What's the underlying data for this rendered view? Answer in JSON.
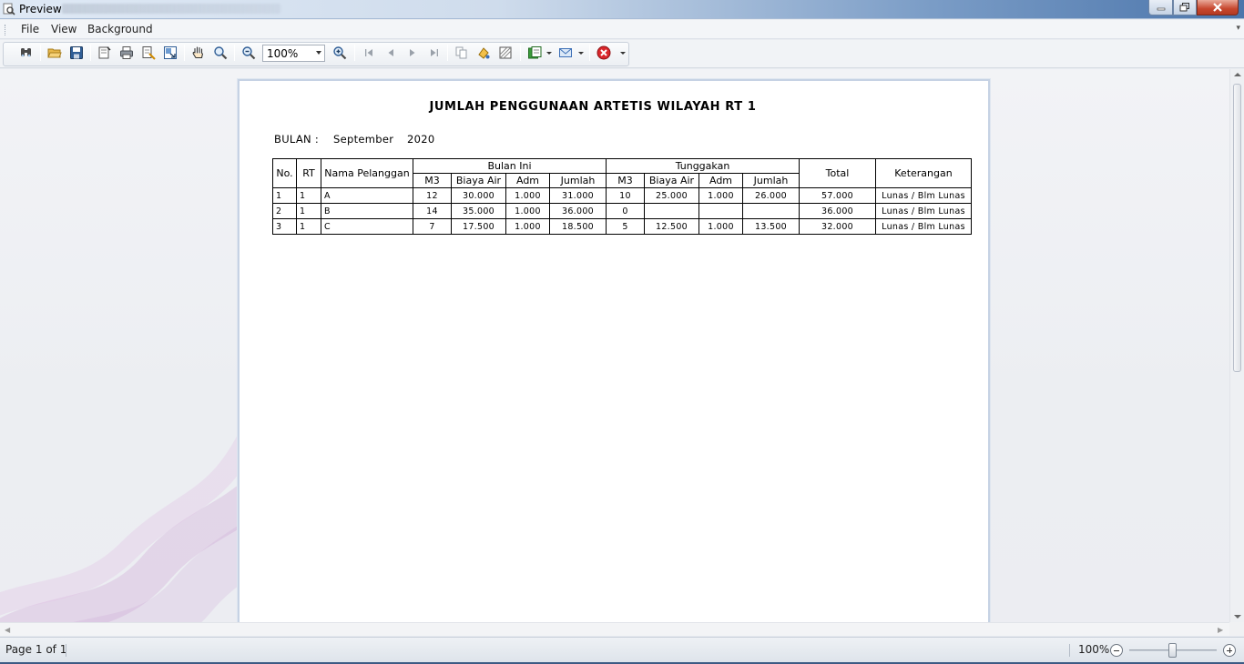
{
  "window": {
    "title": "Preview",
    "icon": "magnifier-document-icon"
  },
  "menu": {
    "items": [
      {
        "label": "File"
      },
      {
        "label": "View"
      },
      {
        "label": "Background"
      }
    ]
  },
  "toolbar": {
    "zoom_value": "100%",
    "buttons": [
      "search-icon",
      "open-icon",
      "save-icon",
      "page-setup-icon",
      "print-icon",
      "quick-print-icon",
      "export-icon",
      "hand-tool-icon",
      "magnifier-icon",
      "zoom-out-icon",
      "zoom-in-icon",
      "first-page-icon",
      "previous-page-icon",
      "next-page-icon",
      "last-page-icon",
      "multiple-pages-icon",
      "color-icon",
      "watermark-icon",
      "export-document-icon",
      "email-icon",
      "close-preview-icon"
    ]
  },
  "report": {
    "title": "JUMLAH PENGGUNAAN ARTETIS WILAYAH  RT  1",
    "month_label": "BULAN :",
    "month": "September",
    "year": "2020",
    "headers": {
      "no": "No.",
      "rt": "RT",
      "name": "Nama Pelanggan",
      "group_current": "Bulan Ini",
      "group_arrears": "Tunggakan",
      "m3": "M3",
      "water_cost": "Biaya Air",
      "adm": "Adm",
      "sum": "Jumlah",
      "total": "Total",
      "notes": "Keterangan"
    },
    "rows": [
      {
        "no": "1",
        "rt": "1",
        "name": "A",
        "m3": "12",
        "water": "30.000",
        "adm": "1.000",
        "sum": "31.000",
        "a_m3": "10",
        "a_water": "25.000",
        "a_adm": "1.000",
        "a_sum": "26.000",
        "total": "57.000",
        "notes": "Lunas / Blm Lunas"
      },
      {
        "no": "2",
        "rt": "1",
        "name": "B",
        "m3": "14",
        "water": "35.000",
        "adm": "1.000",
        "sum": "36.000",
        "a_m3": "0",
        "a_water": "",
        "a_adm": "",
        "a_sum": "",
        "total": "36.000",
        "notes": "Lunas / Blm Lunas"
      },
      {
        "no": "3",
        "rt": "1",
        "name": "C",
        "m3": "7",
        "water": "17.500",
        "adm": "1.000",
        "sum": "18.500",
        "a_m3": "5",
        "a_water": "12.500",
        "a_adm": "1.000",
        "a_sum": "13.500",
        "total": "32.000",
        "notes": "Lunas / Blm Lunas"
      }
    ]
  },
  "status": {
    "page": "Page 1 of 1",
    "zoom": "100%",
    "zoom_level_percent": 100
  }
}
